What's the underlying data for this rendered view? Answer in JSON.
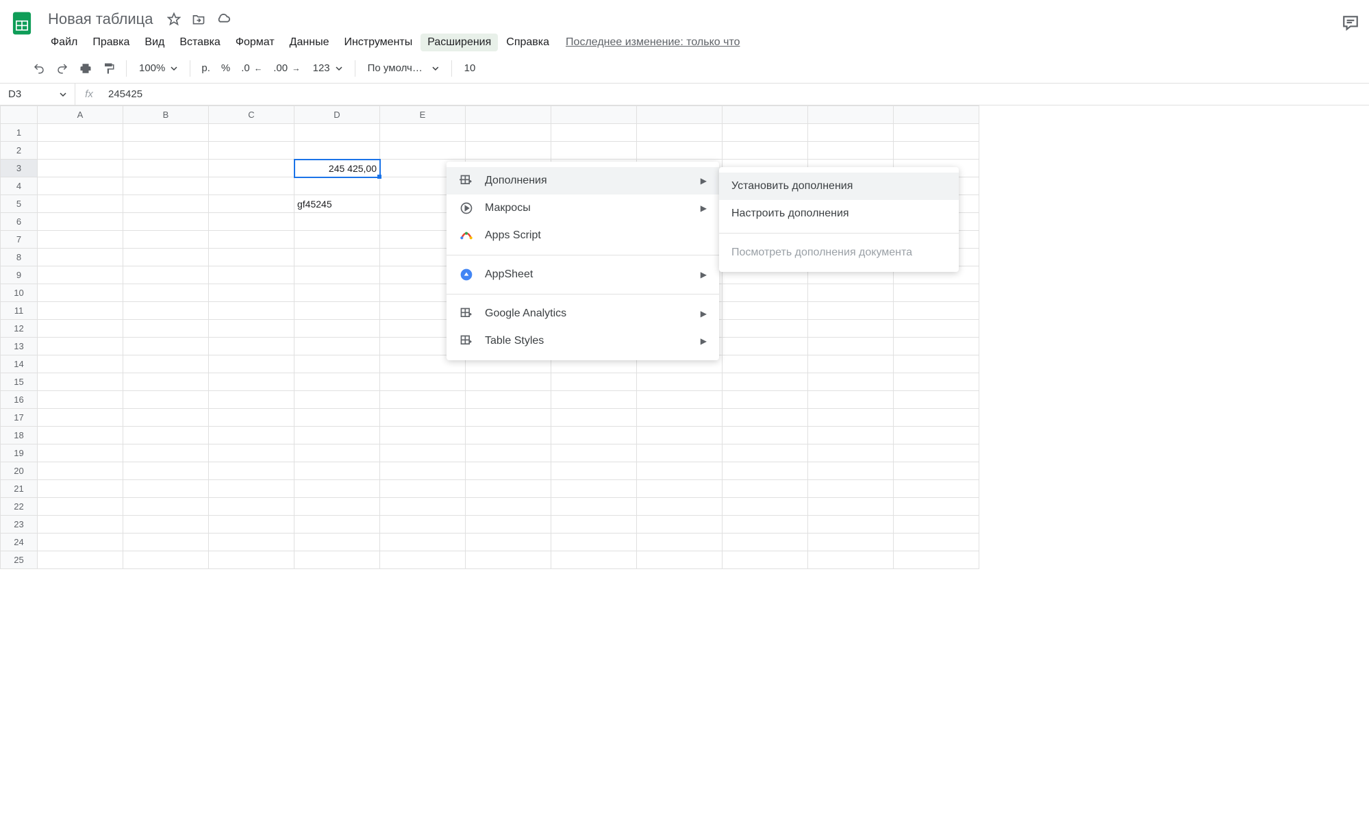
{
  "doc": {
    "title": "Новая таблица"
  },
  "menus": [
    "Файл",
    "Правка",
    "Вид",
    "Вставка",
    "Формат",
    "Данные",
    "Инструменты",
    "Расширения",
    "Справка"
  ],
  "active_menu_index": 7,
  "last_edit": "Последнее изменение: только что",
  "toolbar": {
    "zoom": "100%",
    "currency": "р.",
    "percent": "%",
    "dec_minus": ".0",
    "dec_plus": ".00",
    "num_format": "123",
    "font": "По умолча…",
    "font_size": "10"
  },
  "namebox": "D3",
  "formula": "245425",
  "columns": [
    "A",
    "B",
    "C",
    "D",
    "E"
  ],
  "more_columns": 6,
  "rows": 25,
  "selected": {
    "row": 3,
    "col": "D"
  },
  "cells": {
    "D3": "245 425,00",
    "D5": "gf45245"
  },
  "ext_menu": [
    {
      "label": "Дополнения",
      "icon": "addon",
      "arrow": true,
      "highlighted": true
    },
    {
      "label": "Макросы",
      "icon": "macro",
      "arrow": true
    },
    {
      "label": "Apps Script",
      "icon": "script"
    },
    {
      "sep": true
    },
    {
      "label": "AppSheet",
      "icon": "appsheet",
      "arrow": true
    },
    {
      "sep": true
    },
    {
      "label": "Google Analytics",
      "icon": "analytics",
      "arrow": true
    },
    {
      "label": "Table Styles",
      "icon": "tablestyles",
      "arrow": true
    }
  ],
  "sub_menu": [
    {
      "label": "Установить дополнения",
      "highlighted": true
    },
    {
      "label": "Настроить дополнения"
    },
    {
      "sep": true
    },
    {
      "label": "Посмотреть дополнения документа",
      "disabled": true
    }
  ]
}
